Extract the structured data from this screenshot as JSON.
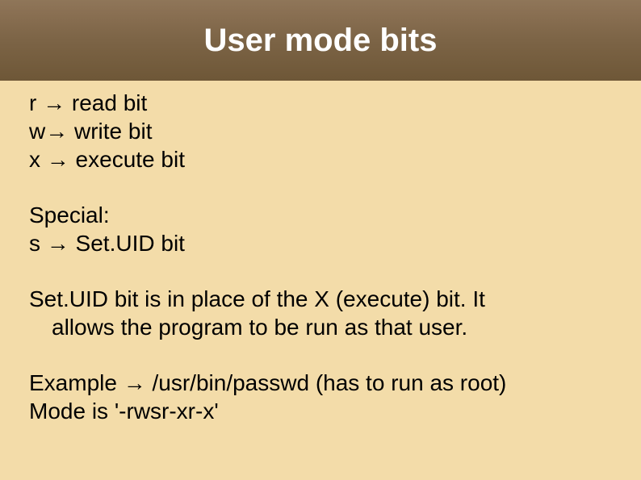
{
  "title": "User mode bits",
  "bits": {
    "r": "r  → read bit",
    "w": "w→ write bit",
    "x": "x → execute bit"
  },
  "special": {
    "label": "Special:",
    "s": "s → Set.UID bit"
  },
  "explanation": {
    "line1": "Set.UID bit is in place of the X (execute) bit. It",
    "line2": "allows the program to be run as that user."
  },
  "example": {
    "line1": "Example → /usr/bin/passwd (has to run as root)",
    "line2": "Mode is '-rwsr-xr-x'"
  }
}
